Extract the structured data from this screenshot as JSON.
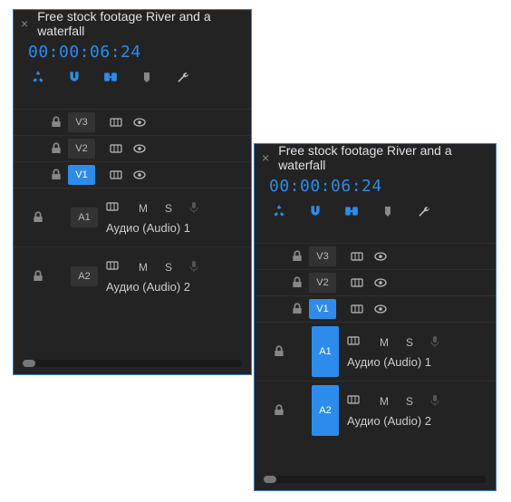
{
  "panel1": {
    "title": "Free stock footage River and a waterfall",
    "timecode": "00:00:06:24",
    "vtracks": [
      {
        "id": "V3",
        "selected": false
      },
      {
        "id": "V2",
        "selected": false
      },
      {
        "id": "V1",
        "selected": true
      }
    ],
    "atracks": [
      {
        "id": "A1",
        "selected": false,
        "m": "M",
        "s": "S",
        "name": "Аудио (Audio) 1"
      },
      {
        "id": "A2",
        "selected": false,
        "m": "M",
        "s": "S",
        "name": "Аудио (Audio) 2"
      }
    ]
  },
  "panel2": {
    "title": "Free stock footage River and a waterfall",
    "timecode": "00:00:06:24",
    "vtracks": [
      {
        "id": "V3",
        "selected": false
      },
      {
        "id": "V2",
        "selected": false
      },
      {
        "id": "V1",
        "selected": true
      }
    ],
    "atracks": [
      {
        "id": "A1",
        "selected": true,
        "m": "M",
        "s": "S",
        "name": "Аудио (Audio) 1"
      },
      {
        "id": "A2",
        "selected": true,
        "m": "M",
        "s": "S",
        "name": "Аудио (Audio) 2"
      }
    ]
  }
}
